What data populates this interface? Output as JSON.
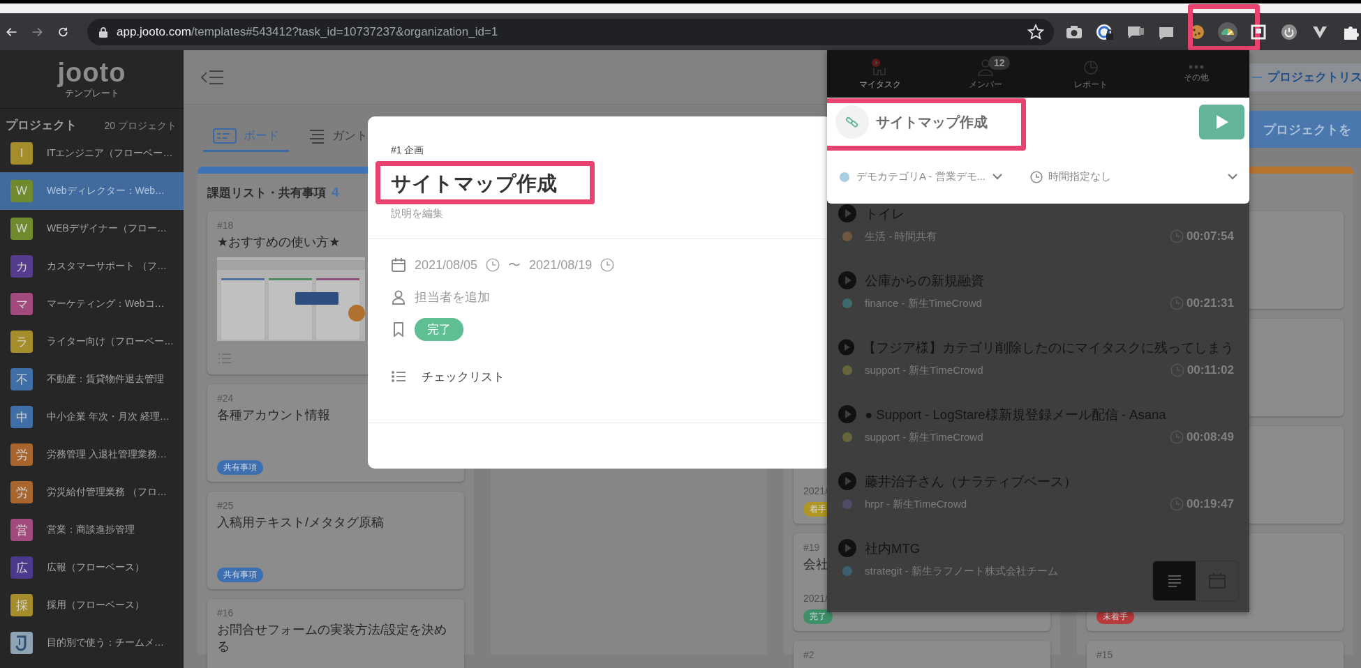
{
  "browser": {
    "host": "app.jooto.com",
    "path": "/templates#543412?task_id=10737237&organization_id=1",
    "extensions": [
      {
        "kind": "camera",
        "highlighted": false
      },
      {
        "kind": "lock",
        "highlighted": false
      },
      {
        "kind": "chat",
        "highlighted": false
      },
      {
        "kind": "video",
        "highlighted": false
      },
      {
        "kind": "cookie",
        "highlighted": false
      },
      {
        "kind": "gauge",
        "highlighted": true
      },
      {
        "kind": "square",
        "highlighted": false
      },
      {
        "kind": "power",
        "highlighted": false
      },
      {
        "kind": "triangle",
        "highlighted": false
      },
      {
        "kind": "puzzle",
        "highlighted": false
      }
    ]
  },
  "sidebar": {
    "logo": "jooto",
    "logo_caption": "テンプレート",
    "heading": "プロジェクト",
    "count": "20 プロジェクト",
    "projects": [
      {
        "kind": "letter",
        "initial": "I",
        "name": "ITエンジニア（フローベー…",
        "color": "#a48d2a",
        "selected": false
      },
      {
        "kind": "letter",
        "initial": "W",
        "name": "Webディレクター：Web…",
        "color": "#6f8b2e",
        "selected": true
      },
      {
        "kind": "letter",
        "initial": "W",
        "name": "WEBデザイナー（フロー…",
        "color": "#6f8b2e",
        "selected": false
      },
      {
        "kind": "letter",
        "initial": "カ",
        "name": "カスタマーサポート （フ…",
        "color": "#553c8c",
        "selected": false
      },
      {
        "kind": "letter",
        "initial": "マ",
        "name": "マーケティング：Webコ…",
        "color": "#a24a7d",
        "selected": false
      },
      {
        "kind": "letter",
        "initial": "ラ",
        "name": "ライター向け（フローベー…",
        "color": "#a48d2a",
        "selected": false
      },
      {
        "kind": "letter",
        "initial": "不",
        "name": "不動産：賃貸物件退去管理",
        "color": "#3f6fa6",
        "selected": false
      },
      {
        "kind": "letter",
        "initial": "中",
        "name": "中小企業 年次・月次 経理…",
        "color": "#3f6fa6",
        "selected": false
      },
      {
        "kind": "letter",
        "initial": "労",
        "name": "労務管理 入退社管理業務…",
        "color": "#a8662e",
        "selected": false
      },
      {
        "kind": "letter",
        "initial": "労",
        "name": "労災給付管理業務 （フロ…",
        "color": "#a8662e",
        "selected": false
      },
      {
        "kind": "letter",
        "initial": "営",
        "name": "営業：商談進捗管理",
        "color": "#a24a7d",
        "selected": false
      },
      {
        "kind": "letter",
        "initial": "広",
        "name": "広報（フローベース）",
        "color": "#4b3a8c",
        "selected": false
      },
      {
        "kind": "letter",
        "initial": "採",
        "name": "採用（フローベース）",
        "color": "#a48d2a",
        "selected": false
      },
      {
        "kind": "logo",
        "name": "目的別で使う：チームメ…",
        "color": "#8fa3b3",
        "selected": false
      }
    ]
  },
  "board": {
    "link": "プロジェクトリス",
    "copy_button": "プロジェクトを",
    "tabs": [
      {
        "kind": "board",
        "label": "ボード",
        "selected": true
      },
      {
        "kind": "gantt",
        "label": "ガント",
        "selected": false
      }
    ],
    "columns": [
      {
        "title": "課題リスト・共有事項",
        "count": "4",
        "color": "#3f73b5",
        "cards": [
          {
            "number": "#18",
            "title": "★おすすめの使い方★"
          },
          {
            "kind": "text",
            "number": "#24",
            "title": "各種アカウント情報",
            "tag": {
              "label": "共有事項",
              "color": "#3d6fb0"
            }
          },
          {
            "kind": "text",
            "number": "#25",
            "title": "入稿用テキスト/メタタグ原稿",
            "tag": {
              "label": "共有事項",
              "color": "#3d6fb0"
            }
          },
          {
            "kind": "text",
            "number": "#16",
            "title": "お問合せフォームの実装方法/設定を決める"
          }
        ]
      },
      {},
      {
        "cards": [
          {
            "kind": "text",
            "date": "2021/",
            "tag": {
              "label": "着手",
              "color": "#b09624"
            }
          },
          {
            "kind": "text",
            "number": "#19",
            "title": "会社",
            "date": "2021/",
            "tag": {
              "label": "完了",
              "color": "#3f9068"
            }
          },
          {
            "kind": "text",
            "number": "#2"
          }
        ]
      },
      {
        "color": "#b8732e",
        "cards": [
          {
            "kind": "text"
          },
          {
            "kind": "text"
          },
          {
            "kind": "text"
          },
          {
            "kind": "text",
            "tag": {
              "label": "未着手",
              "color": "#b83a3a"
            }
          },
          {
            "kind": "text",
            "number": "#15"
          }
        ]
      }
    ]
  },
  "modal": {
    "ref": "#1 企画",
    "title": "サイトマップ作成",
    "highlighted": true,
    "description": {
      "placeholder": "説明を編集"
    },
    "start": "2021/08/05",
    "separator": "〜",
    "end": "2021/08/19",
    "assignee": "担当者を追加",
    "status": "完了",
    "checklist": "チェックリスト"
  },
  "popup": {
    "tabs": [
      {
        "kind": "tasks",
        "label": "マイタスク",
        "selected": true
      },
      {
        "kind": "members",
        "label": "メンバー",
        "badge": "12",
        "selected": false
      },
      {
        "kind": "report",
        "label": "レポート",
        "selected": false
      },
      {
        "kind": "more",
        "label": "その他",
        "selected": false
      }
    ],
    "current": {
      "title": "サイトマップ作成",
      "highlighted": true,
      "category": "デモカテゴリA - 営業デモ...",
      "color": "#a9cde3",
      "schedule": "時間指定なし"
    },
    "entries": [
      {
        "title": "トイレ",
        "category": "生活 - 時間共有",
        "color": "#6e5840",
        "time": "00:07:54"
      },
      {
        "title": "公庫からの新規融資",
        "category": "finance - 新生TimeCrowd",
        "color": "#3d6b6b",
        "time": "00:21:31"
      },
      {
        "title": "【フジア様】カテゴリ削除したのにマイタスクに残ってしまう",
        "category": "support - 新生TimeCrowd",
        "color": "#66663d",
        "time": "00:11:02"
      },
      {
        "title": "● Support - LogStare様新規登録メール配信 - Asana",
        "category": "support - 新生TimeCrowd",
        "color": "#66663d",
        "time": "00:08:49"
      },
      {
        "title": "藤井治子さん（ナラティブベース）",
        "category": "hrpr - 新生TimeCrowd",
        "color": "#4d4d66",
        "time": "00:19:47"
      },
      {
        "title": "社内MTG",
        "category": "strategit - 新生ラフノート株式会社チーム",
        "color": "#3d6070"
      }
    ],
    "views": [
      {
        "kind": "list",
        "selected": true
      },
      {
        "kind": "calendar",
        "selected": false
      }
    ]
  }
}
